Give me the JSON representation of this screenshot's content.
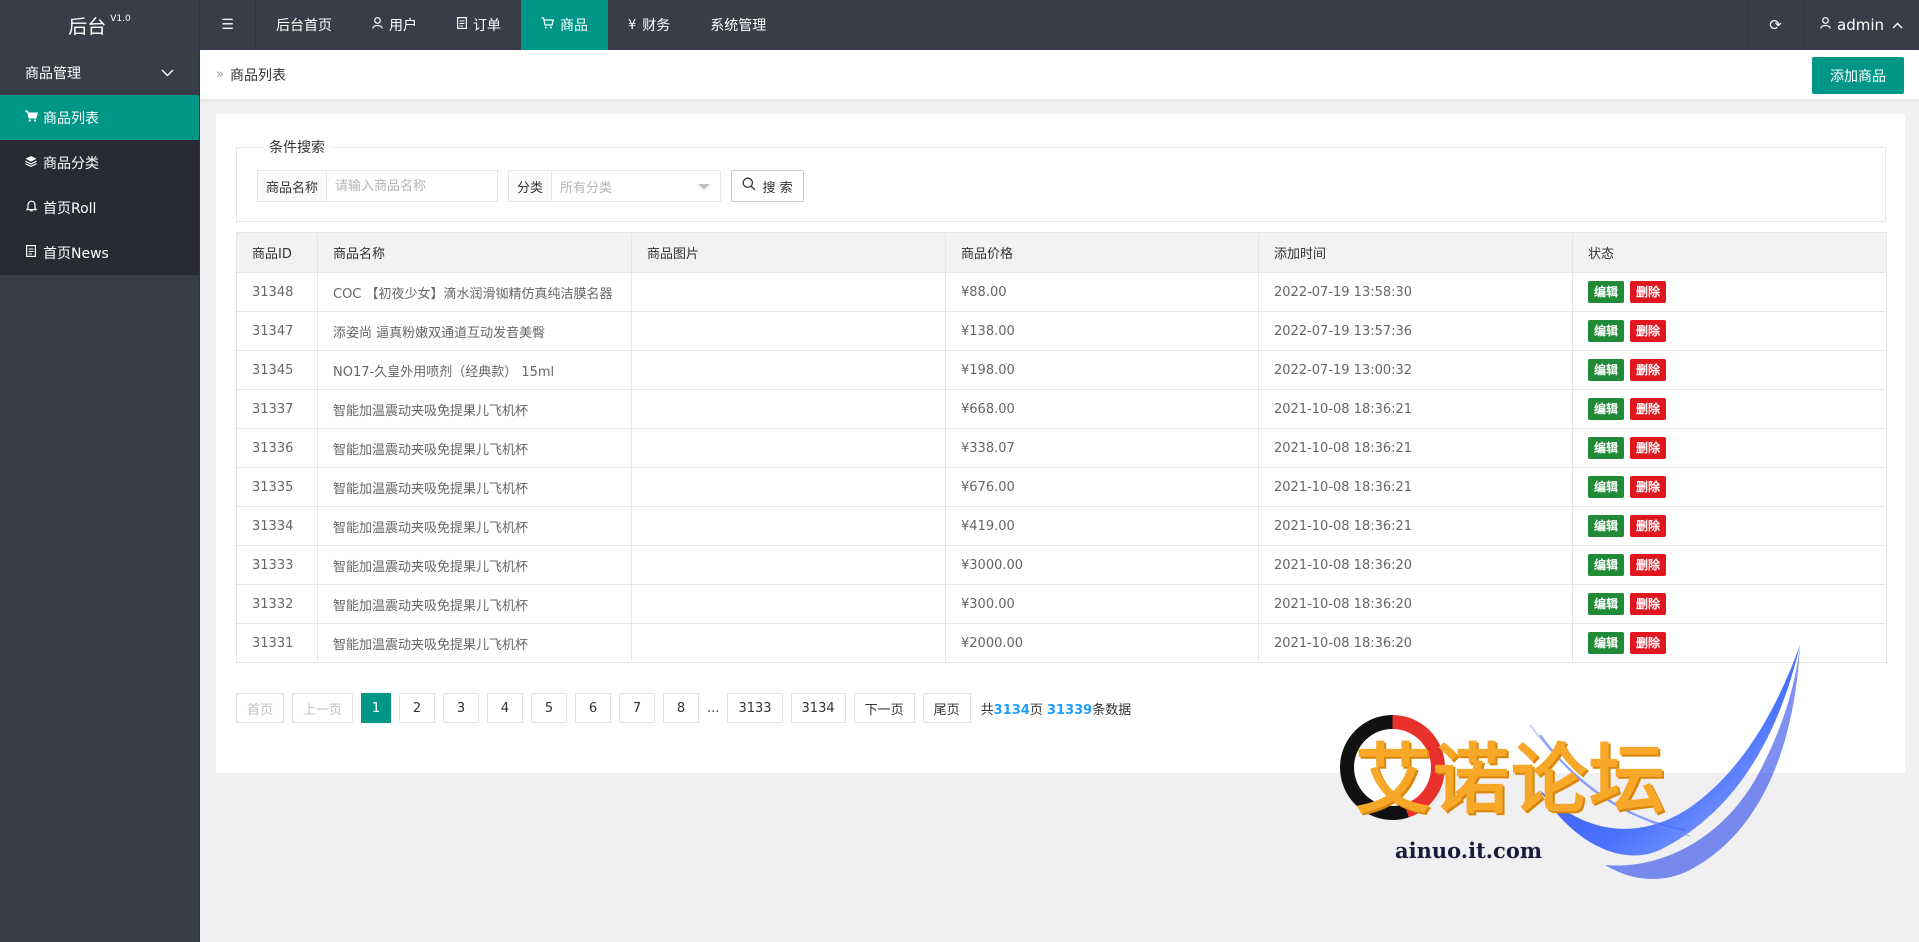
{
  "app": {
    "title": "后台",
    "version": "V1.0"
  },
  "nav": {
    "items": [
      {
        "label": "后台首页",
        "icon": ""
      },
      {
        "label": "用户",
        "icon": "user-icon"
      },
      {
        "label": "订单",
        "icon": "document-icon"
      },
      {
        "label": "商品",
        "icon": "cart-icon"
      },
      {
        "label": "财务",
        "icon": "yen-icon"
      },
      {
        "label": "系统管理",
        "icon": ""
      }
    ],
    "active_index": 3
  },
  "user": {
    "name": "admin"
  },
  "sidebar": {
    "group": {
      "label": "商品管理"
    },
    "items": [
      {
        "label": "商品列表",
        "icon": "cart-icon",
        "active": true
      },
      {
        "label": "商品分类",
        "icon": "layers-icon",
        "active": false
      },
      {
        "label": "首页Roll",
        "icon": "bell-icon",
        "active": false
      },
      {
        "label": "首页News",
        "icon": "document-icon",
        "active": false
      }
    ]
  },
  "breadcrumb": {
    "current": "商品列表"
  },
  "toolbar": {
    "add_label": "添加商品"
  },
  "search": {
    "legend": "条件搜索",
    "name_label": "商品名称",
    "name_placeholder": "请输入商品名称",
    "category_label": "分类",
    "category_value": "所有分类",
    "button_label": "搜 索"
  },
  "table": {
    "headers": [
      "商品ID",
      "商品名称",
      "商品图片",
      "商品价格",
      "添加时间",
      "状态"
    ],
    "edit_label": "编辑",
    "delete_label": "删除",
    "rows": [
      {
        "id": "31348",
        "name": "COC 【初夜少女】滴水润滑铷精仿真纯洁膜名器",
        "image": "",
        "price": "¥88.00",
        "time": "2022-07-19 13:58:30"
      },
      {
        "id": "31347",
        "name": "添姿尚 逼真粉嫩双通道互动发音美臀",
        "image": "",
        "price": "¥138.00",
        "time": "2022-07-19 13:57:36"
      },
      {
        "id": "31345",
        "name": "NO17-久皇外用喷剂（经典款） 15ml",
        "image": "",
        "price": "¥198.00",
        "time": "2022-07-19 13:00:32"
      },
      {
        "id": "31337",
        "name": "智能加温震动夹吸免提果儿飞机杯",
        "image": "",
        "price": "¥668.00",
        "time": "2021-10-08 18:36:21"
      },
      {
        "id": "31336",
        "name": "智能加温震动夹吸免提果儿飞机杯",
        "image": "",
        "price": "¥338.07",
        "time": "2021-10-08 18:36:21"
      },
      {
        "id": "31335",
        "name": "智能加温震动夹吸免提果儿飞机杯",
        "image": "",
        "price": "¥676.00",
        "time": "2021-10-08 18:36:21"
      },
      {
        "id": "31334",
        "name": "智能加温震动夹吸免提果儿飞机杯",
        "image": "",
        "price": "¥419.00",
        "time": "2021-10-08 18:36:21"
      },
      {
        "id": "31333",
        "name": "智能加温震动夹吸免提果儿飞机杯",
        "image": "",
        "price": "¥3000.00",
        "time": "2021-10-08 18:36:20"
      },
      {
        "id": "31332",
        "name": "智能加温震动夹吸免提果儿飞机杯",
        "image": "",
        "price": "¥300.00",
        "time": "2021-10-08 18:36:20"
      },
      {
        "id": "31331",
        "name": "智能加温震动夹吸免提果儿飞机杯",
        "image": "",
        "price": "¥2000.00",
        "time": "2021-10-08 18:36:20"
      }
    ]
  },
  "pager": {
    "first": "首页",
    "prev": "上一页",
    "pages": [
      "1",
      "2",
      "3",
      "4",
      "5",
      "6",
      "7",
      "8"
    ],
    "current": "1",
    "ellipsis": "...",
    "tail_pages": [
      "3133",
      "3134"
    ],
    "next": "下一页",
    "last": "尾页",
    "info_prefix": "共",
    "total_pages": "3134",
    "info_mid": "页 ",
    "total_records": "31339",
    "info_suffix": "条数据"
  },
  "watermark": {
    "text": "艾诺论坛",
    "url": "ainuo.it.com"
  },
  "colors": {
    "accent": "#009688",
    "header": "#393d49",
    "edit": "#218a37",
    "delete": "#e0171f",
    "info": "#1e9fff"
  }
}
